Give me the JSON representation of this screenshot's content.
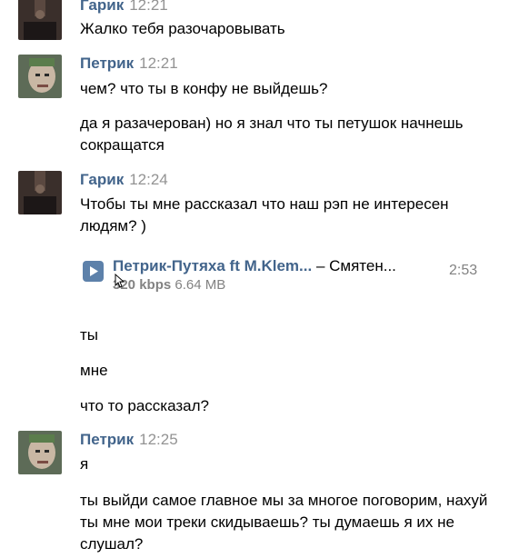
{
  "messages": [
    {
      "author": "Гарик",
      "time": "12:21",
      "lines": [
        "Жалко тебя разочаровывать"
      ]
    },
    {
      "author": "Петрик",
      "time": "12:21",
      "lines": [
        "чем? что ты в конфу не выйдешь?",
        "да я разачерован) но я знал что ты петушок начнешь сокращатся"
      ]
    },
    {
      "author": "Гарик",
      "time": "12:24",
      "lines": [
        "Чтобы ты мне рассказал что наш рэп не интересен людям? )",
        "ты",
        "мне",
        "что то рассказал?"
      ]
    },
    {
      "author": "Петрик",
      "time": "12:25",
      "lines": [
        "я",
        "ты выйди самое главное мы за многое поговорим, нахуй ты мне мои треки скидываешь? ты думаешь я их не слушал?"
      ]
    }
  ],
  "attachment": {
    "artist": "Петрик-Путяха ft M.Klem...",
    "separator": " – ",
    "title": "Смятен...",
    "duration": "2:53",
    "bitrate": "320 kbps",
    "size": "6.64 MB",
    "icon": "play-icon"
  },
  "colors": {
    "author": "#42648b",
    "time": "#939393",
    "attachment_icon": "#5d81aa"
  }
}
